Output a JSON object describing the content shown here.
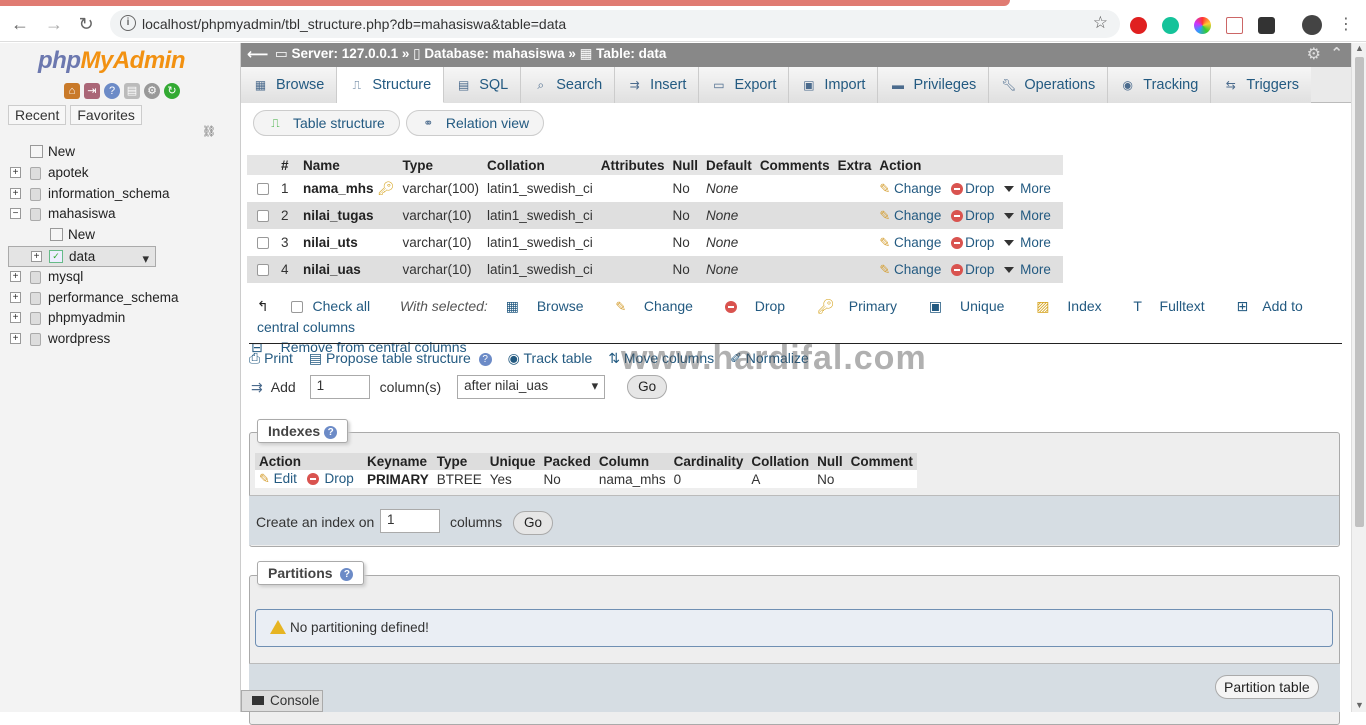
{
  "browser": {
    "url": "localhost/phpmyadmin/tbl_structure.php?db=mahasiswa&table=data"
  },
  "sidebar": {
    "logo_php": "php",
    "logo_my": "MyAdmin",
    "tab_recent": "Recent",
    "tab_favorites": "Favorites",
    "tree": [
      {
        "label": "New",
        "type": "new",
        "level": 0
      },
      {
        "label": "apotek",
        "type": "db",
        "level": 0
      },
      {
        "label": "information_schema",
        "type": "db",
        "level": 0
      },
      {
        "label": "mahasiswa",
        "type": "db",
        "level": 0,
        "expanded": true
      },
      {
        "label": "New",
        "type": "new",
        "level": 1
      },
      {
        "label": "data",
        "type": "table",
        "level": 1,
        "selected": true
      },
      {
        "label": "mysql",
        "type": "db",
        "level": 0
      },
      {
        "label": "performance_schema",
        "type": "db",
        "level": 0
      },
      {
        "label": "phpmyadmin",
        "type": "db",
        "level": 0
      },
      {
        "label": "wordpress",
        "type": "db",
        "level": 0
      }
    ]
  },
  "breadcrumb": {
    "server": "Server: 127.0.0.1",
    "database": "Database: mahasiswa",
    "table": "Table: data"
  },
  "tabs": [
    "Browse",
    "Structure",
    "SQL",
    "Search",
    "Insert",
    "Export",
    "Import",
    "Privileges",
    "Operations",
    "Tracking",
    "Triggers"
  ],
  "active_tab": "Structure",
  "sub": {
    "table_structure": "Table structure",
    "relation_view": "Relation view"
  },
  "structure": {
    "headers": [
      "#",
      "Name",
      "Type",
      "Collation",
      "Attributes",
      "Null",
      "Default",
      "Comments",
      "Extra",
      "Action"
    ],
    "rows": [
      {
        "num": "1",
        "name": "nama_mhs",
        "type": "varchar(100)",
        "collation": "latin1_swedish_ci",
        "null": "No",
        "default": "None",
        "primary": true
      },
      {
        "num": "2",
        "name": "nilai_tugas",
        "type": "varchar(10)",
        "collation": "latin1_swedish_ci",
        "null": "No",
        "default": "None"
      },
      {
        "num": "3",
        "name": "nilai_uts",
        "type": "varchar(10)",
        "collation": "latin1_swedish_ci",
        "null": "No",
        "default": "None"
      },
      {
        "num": "4",
        "name": "nilai_uas",
        "type": "varchar(10)",
        "collation": "latin1_swedish_ci",
        "null": "No",
        "default": "None"
      }
    ],
    "action_change": "Change",
    "action_drop": "Drop",
    "action_more": "More"
  },
  "with_selected": {
    "check_all": "Check all",
    "label": "With selected:",
    "browse": "Browse",
    "change": "Change",
    "drop": "Drop",
    "primary": "Primary",
    "unique": "Unique",
    "index": "Index",
    "fulltext": "Fulltext",
    "add_central": "Add to central columns",
    "remove_central": "Remove from central columns"
  },
  "tools": {
    "print": "Print",
    "propose": "Propose table structure",
    "track": "Track table",
    "move": "Move columns",
    "normalize": "Normalize"
  },
  "watermark": "www.hardifal.com",
  "add_columns": {
    "label": "Add",
    "count": "1",
    "unit": "column(s)",
    "position": "after nilai_uas",
    "go": "Go"
  },
  "indexes": {
    "title": "Indexes",
    "headers": [
      "Action",
      "Keyname",
      "Type",
      "Unique",
      "Packed",
      "Column",
      "Cardinality",
      "Collation",
      "Null",
      "Comment"
    ],
    "row": {
      "edit": "Edit",
      "drop": "Drop",
      "keyname": "PRIMARY",
      "type": "BTREE",
      "unique": "Yes",
      "packed": "No",
      "column": "nama_mhs",
      "cardinality": "0",
      "collation": "A",
      "null": "No",
      "comment": ""
    },
    "create_label": "Create an index on",
    "create_count": "1",
    "create_unit": "columns",
    "go": "Go"
  },
  "partitions": {
    "title": "Partitions",
    "message": "No partitioning defined!",
    "button": "Partition table"
  },
  "console": "Console"
}
